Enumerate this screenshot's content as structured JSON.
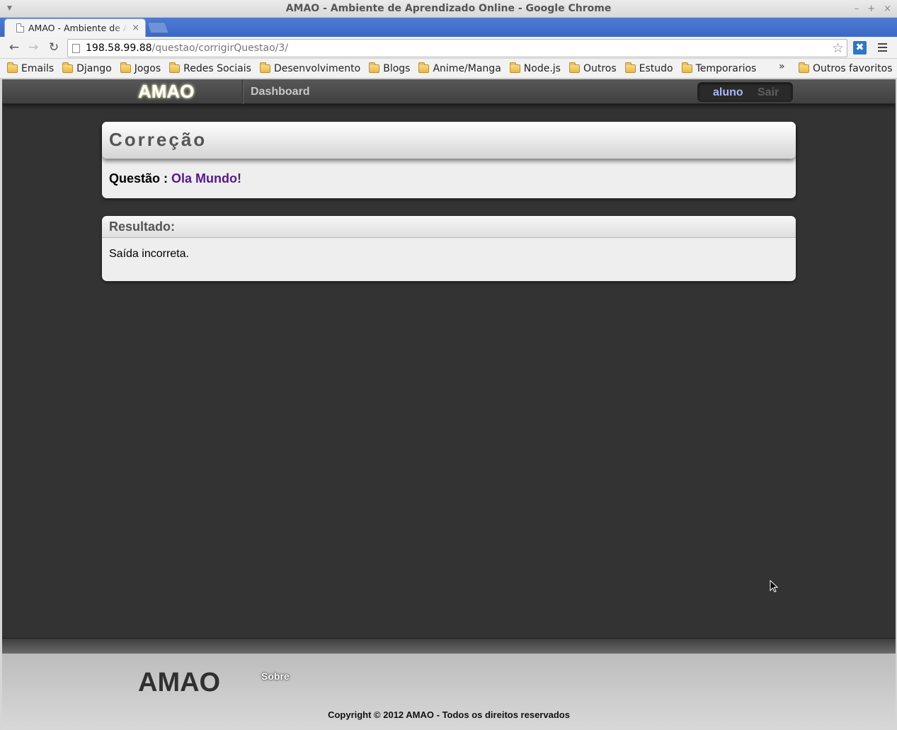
{
  "window": {
    "title": "AMAO - Ambiente de Aprendizado Online - Google Chrome",
    "controls": [
      "–",
      "+",
      "×"
    ]
  },
  "tab": {
    "title": "AMAO - Ambiente de Aprendizado Online",
    "close": "×"
  },
  "toolbar": {
    "url_host": "198.58.99.88",
    "url_path": "/questao/corrigirQuestao/3/"
  },
  "bookmarks": {
    "items": [
      "Emails",
      "Django",
      "Jogos",
      "Redes Sociais",
      "Desenvolvimento",
      "Blogs",
      "Anime/Manga",
      "Node.js",
      "Outros",
      "Estudo",
      "Temporarios"
    ],
    "more": "»",
    "other": "Outros favoritos"
  },
  "header": {
    "brand": "AMAO",
    "nav": "Dashboard",
    "user": "aluno",
    "logout": "Sair"
  },
  "correcao": {
    "title": "Correção",
    "questao_label": "Questão : ",
    "questao_name": "Ola Mundo!"
  },
  "resultado": {
    "title": "Resultado:",
    "text": "Saída incorreta."
  },
  "footer": {
    "brand": "AMAO",
    "sobre": "Sobre",
    "copyright": "Copyright © 2012 AMAO - Todos os direitos reservados"
  },
  "colors": {
    "page_bg": "#333333",
    "visited_link": "#551a8b",
    "user_link": "#a8b8f4"
  }
}
